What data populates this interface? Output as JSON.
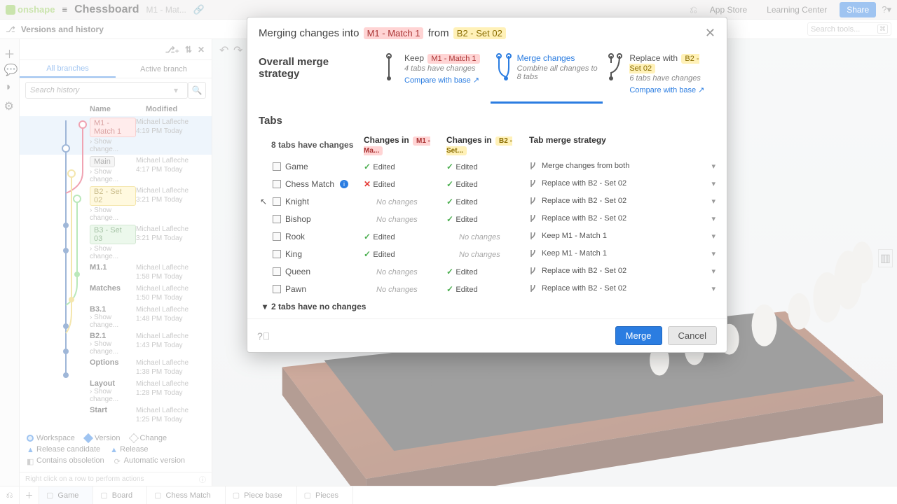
{
  "app": {
    "logo": "onshape"
  },
  "doc": {
    "title": "Chessboard",
    "subtitle": "M1 - Mat..."
  },
  "topbar": {
    "app_store": "App Store",
    "learning": "Learning Center",
    "share": "Share"
  },
  "secondbar": {
    "title": "Versions and history",
    "search_placeholder": "Search tools..."
  },
  "side_tabs": {
    "all": "All branches",
    "active": "Active branch"
  },
  "side_search_placeholder": "Search history",
  "side_th": {
    "name": "Name",
    "modified": "Modified"
  },
  "tree": [
    {
      "name": "M1 - Match 1",
      "chip": "chip-red",
      "author": "Michael Lafleche",
      "time": "4:19 PM Today",
      "show": "Show change...",
      "sel": true
    },
    {
      "name": "Main",
      "chip": "chip-gray",
      "author": "Michael Lafleche",
      "time": "4:17 PM Today",
      "show": "Show change..."
    },
    {
      "name": "B2 - Set 02",
      "chip": "chip-yellow",
      "author": "Michael Lafleche",
      "time": "3:21 PM Today",
      "show": "Show change..."
    },
    {
      "name": "B3 - Set 03",
      "chip": "chip-green",
      "author": "Michael Lafleche",
      "time": "3:21 PM Today",
      "show": "Show change..."
    },
    {
      "name": "M1.1",
      "author": "Michael Lafleche",
      "time": "1:58 PM Today"
    },
    {
      "name": "Matches",
      "author": "Michael Lafleche",
      "time": "1:50 PM Today"
    },
    {
      "name": "B3.1",
      "author": "Michael Lafleche",
      "time": "1:48 PM Today",
      "show": "Show change..."
    },
    {
      "name": "B2.1",
      "author": "Michael Lafleche",
      "time": "1:43 PM Today",
      "show": "Show change..."
    },
    {
      "name": "Options",
      "author": "Michael Lafleche",
      "time": "1:38 PM Today"
    },
    {
      "name": "Layout",
      "author": "Michael Lafleche",
      "time": "1:28 PM Today",
      "show": "Show change..."
    },
    {
      "name": "Start",
      "author": "Michael Lafleche",
      "time": "1:25 PM Today"
    }
  ],
  "legend": {
    "workspace": "Workspace",
    "version": "Version",
    "change": "Change",
    "rc": "Release candidate",
    "release": "Release",
    "obsol": "Contains obsoletion",
    "auto": "Automatic version"
  },
  "side_foot": "Right click on a row to perform actions",
  "bottom_tabs": [
    "Game",
    "Board",
    "Chess Match",
    "Piece base",
    "Pieces"
  ],
  "dialog": {
    "title_prefix": "Merging changes into ",
    "title_into": "M1 - Match 1",
    "title_mid": " from ",
    "title_from": "B2 - Set 02",
    "strategy_label": "Overall merge strategy",
    "strat_keep": {
      "title_pre": "Keep ",
      "title_tag": "M1 - Match 1",
      "sub": "4 tabs have changes",
      "link": "Compare with base ↗"
    },
    "strat_merge": {
      "title": "Merge changes",
      "sub": "Combine all changes to 8 tabs"
    },
    "strat_replace": {
      "title_pre": "Replace with ",
      "title_tag": "B2 - Set 02",
      "sub": "6 tabs have changes",
      "link": "Compare with base ↗"
    },
    "tabs_label": "Tabs",
    "headers": {
      "c1": "8 tabs have changes",
      "c2_pre": "Changes in ",
      "c2_tag": "M1 - Ma...",
      "c3_pre": "Changes in ",
      "c3_tag": "B2 - Set...",
      "c4": "Tab merge strategy"
    },
    "rows": [
      {
        "name": "Game",
        "m1": "edited",
        "b2": "edited",
        "strat": "Merge changes from both"
      },
      {
        "name": "Chess Match",
        "info": true,
        "m1": "conflict",
        "b2": "edited",
        "strat": "Replace with B2 - Set 02"
      },
      {
        "name": "Knight",
        "cursor": true,
        "m1": "none",
        "b2": "edited",
        "strat": "Replace with B2 - Set 02"
      },
      {
        "name": "Bishop",
        "m1": "none",
        "b2": "edited",
        "strat": "Replace with B2 - Set 02"
      },
      {
        "name": "Rook",
        "m1": "edited",
        "b2": "none",
        "strat": "Keep M1 - Match 1"
      },
      {
        "name": "King",
        "m1": "edited",
        "b2": "none",
        "strat": "Keep M1 - Match 1"
      },
      {
        "name": "Queen",
        "m1": "none",
        "b2": "edited",
        "strat": "Replace with B2 - Set 02"
      },
      {
        "name": "Pawn",
        "m1": "none",
        "b2": "edited",
        "strat": "Replace with B2 - Set 02"
      }
    ],
    "nochanges": "2 tabs have no changes",
    "merge": "Merge",
    "cancel": "Cancel",
    "edited_label": "Edited",
    "none_label": "No changes"
  }
}
